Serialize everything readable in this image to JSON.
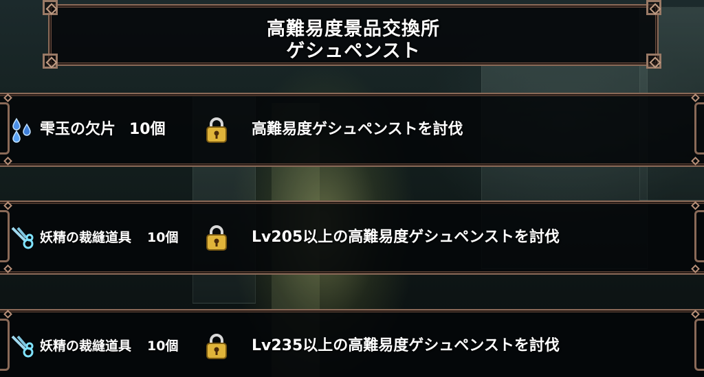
{
  "header": {
    "title_line1": "高難易度景品交換所",
    "title_line2": "ゲシュペンスト"
  },
  "rewards": [
    {
      "item_name": "雫玉の欠片",
      "quantity": "10個",
      "item_icon": "water-drops-icon",
      "locked": true,
      "condition": "高難易度ゲシュペンストを討伐"
    },
    {
      "item_name": "妖精の裁縫道具",
      "quantity": "10個",
      "item_icon": "sewing-scissors-icon",
      "locked": true,
      "condition": "Lv205以上の高難易度ゲシュペンストを討伐"
    },
    {
      "item_name": "妖精の裁縫道具",
      "quantity": "10個",
      "item_icon": "sewing-scissors-icon",
      "locked": true,
      "condition": "Lv235以上の高難易度ゲシュペンストを討伐"
    }
  ],
  "colors": {
    "frame": "#8a6a58",
    "panel": "#050709",
    "text": "#ffffff",
    "lock_gold": "#e0b43a",
    "drop_blue": "#6fb6ff",
    "scissors_cyan": "#7fe3ff"
  }
}
